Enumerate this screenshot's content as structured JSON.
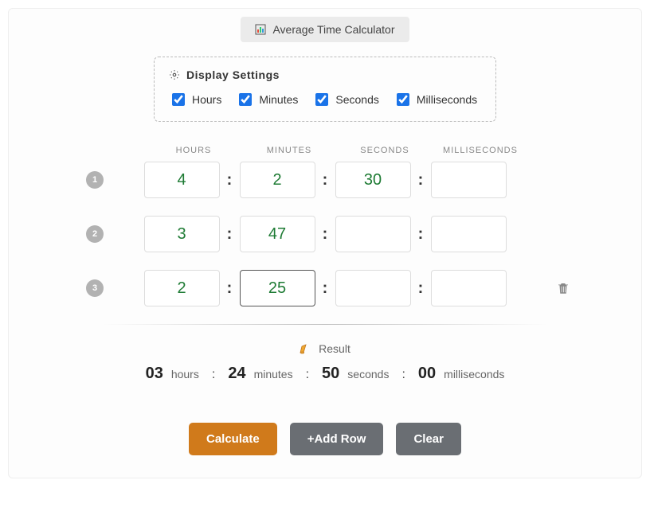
{
  "title": "Average Time Calculator",
  "settings": {
    "heading": "Display Settings",
    "options": [
      {
        "label": "Hours",
        "checked": true
      },
      {
        "label": "Minutes",
        "checked": true
      },
      {
        "label": "Seconds",
        "checked": true
      },
      {
        "label": "Milliseconds",
        "checked": true
      }
    ]
  },
  "columns": {
    "hours": "HOURS",
    "minutes": "MINUTES",
    "seconds": "SECONDS",
    "milliseconds": "MILLISECONDS"
  },
  "rows": [
    {
      "badge": "1",
      "hours": "4",
      "minutes": "2",
      "seconds": "30",
      "milliseconds": "",
      "focused": null,
      "trash": false
    },
    {
      "badge": "2",
      "hours": "3",
      "minutes": "47",
      "seconds": "",
      "milliseconds": "",
      "focused": null,
      "trash": false
    },
    {
      "badge": "3",
      "hours": "2",
      "minutes": "25",
      "seconds": "",
      "milliseconds": "",
      "focused": "minutes",
      "trash": true
    }
  ],
  "separator": ":",
  "result": {
    "heading": "Result",
    "hours": "03",
    "hours_unit": "hours",
    "minutes": "24",
    "minutes_unit": "minutes",
    "seconds": "50",
    "seconds_unit": "seconds",
    "milliseconds": "00",
    "milliseconds_unit": "milliseconds"
  },
  "buttons": {
    "calculate": "Calculate",
    "add_row": "+Add Row",
    "clear": "Clear"
  }
}
